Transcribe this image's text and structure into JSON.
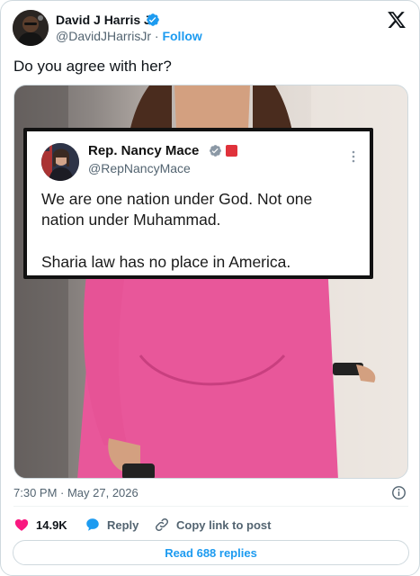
{
  "author": {
    "name": "David J Harris Jr",
    "handle": "@DavidJHarrisJr",
    "separator": "·",
    "follow_label": "Follow"
  },
  "post": {
    "text": "Do you agree with her?",
    "timestamp": "7:30 PM · May 27, 2026"
  },
  "embedded_post": {
    "name": "Rep. Nancy Mace",
    "handle": "@RepNancyMace",
    "line1": "We are one nation under God. Not one",
    "line2": "nation under Muhammad.",
    "line3": "Sharia law has no place in America."
  },
  "actions": {
    "likes": "14.9K",
    "reply_label": "Reply",
    "copy_link_label": "Copy link to post",
    "read_replies_label": "Read 688 replies"
  },
  "icons": {
    "logo": "x-logo-icon",
    "verified": "verified-badge-icon",
    "like": "heart-icon",
    "reply": "speech-bubble-icon",
    "copy": "link-icon",
    "info": "info-icon",
    "more": "more-vertical-icon"
  },
  "colors": {
    "accent": "#1d9bf0",
    "like": "#f91880",
    "text": "#0f1419",
    "muted": "#536471",
    "dress": "#e8579a"
  }
}
